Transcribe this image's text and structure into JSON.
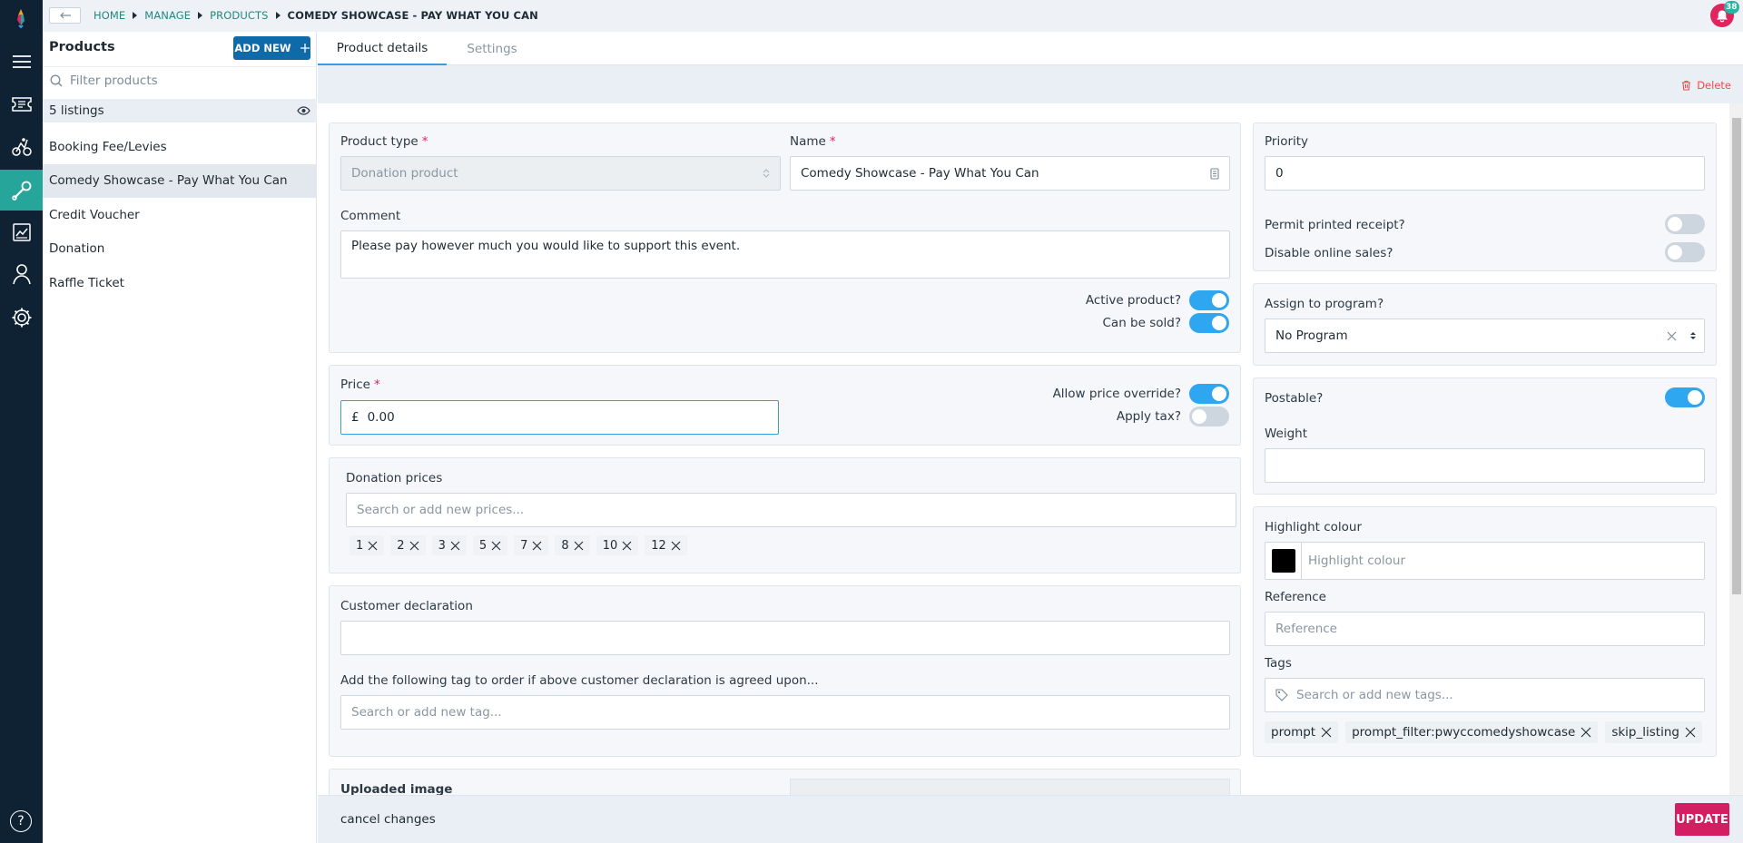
{
  "breadcrumb": {
    "items": [
      "HOME",
      "MANAGE",
      "PRODUCTS",
      "COMEDY SHOWCASE - PAY WHAT YOU CAN"
    ]
  },
  "notifications": {
    "count": "38"
  },
  "sidebar": {
    "title": "Products",
    "add_new_label": "ADD NEW",
    "filter_placeholder": "Filter products",
    "listing_count": "5 listings",
    "items": [
      "Booking Fee/Levies",
      "Comedy Showcase - Pay What You Can",
      "Credit Voucher",
      "Donation",
      "Raffle Ticket"
    ],
    "selected_index": 1
  },
  "tabs": [
    "Product details",
    "Settings"
  ],
  "delete_label": "Delete",
  "form": {
    "product_type_label": "Product type",
    "product_type_value": "Donation product",
    "name_label": "Name",
    "name_value": "Comedy Showcase - Pay What You Can",
    "comment_label": "Comment",
    "comment_value": "Please pay however much you would like to support this event.",
    "active_label": "Active product?",
    "can_be_sold_label": "Can be sold?",
    "price_label": "Price",
    "currency": "£",
    "price_value": "0.00",
    "allow_override_label": "Allow price override?",
    "apply_tax_label": "Apply tax?",
    "donation_prices_label": "Donation prices",
    "donation_prices_placeholder": "Search or add new prices...",
    "donation_prices": [
      "1",
      "2",
      "3",
      "5",
      "7",
      "8",
      "10",
      "12"
    ],
    "customer_declaration_label": "Customer declaration",
    "declaration_tag_label": "Add the following tag to order if above customer declaration is agreed upon...",
    "declaration_tag_placeholder": "Search or add new tag...",
    "uploaded_image_label": "Uploaded image"
  },
  "side_form": {
    "priority_label": "Priority",
    "priority_value": "0",
    "permit_receipt_label": "Permit printed receipt?",
    "disable_online_label": "Disable online sales?",
    "assign_program_label": "Assign to program?",
    "program_value": "No Program",
    "postable_label": "Postable?",
    "weight_label": "Weight",
    "highlight_label": "Highlight colour",
    "highlight_placeholder": "Highlight colour",
    "reference_label": "Reference",
    "reference_placeholder": "Reference",
    "tags_label": "Tags",
    "tags_placeholder": "Search or add new tags...",
    "tags": [
      "prompt",
      "prompt_filter:pwyccomedyshowcase",
      "skip_listing"
    ]
  },
  "toggles": {
    "active": true,
    "can_be_sold": true,
    "allow_override": true,
    "apply_tax": false,
    "permit_receipt": false,
    "disable_online": false,
    "postable": true
  },
  "footer": {
    "cancel_label": "cancel changes",
    "update_label": "UPDATE"
  },
  "colors": {
    "accent": "#26a69a",
    "primary": "#0e6aa8",
    "update": "#d31e62",
    "toggle_on": "#2fa6f0",
    "rail": "#0f2233",
    "swatch": "#000000"
  }
}
